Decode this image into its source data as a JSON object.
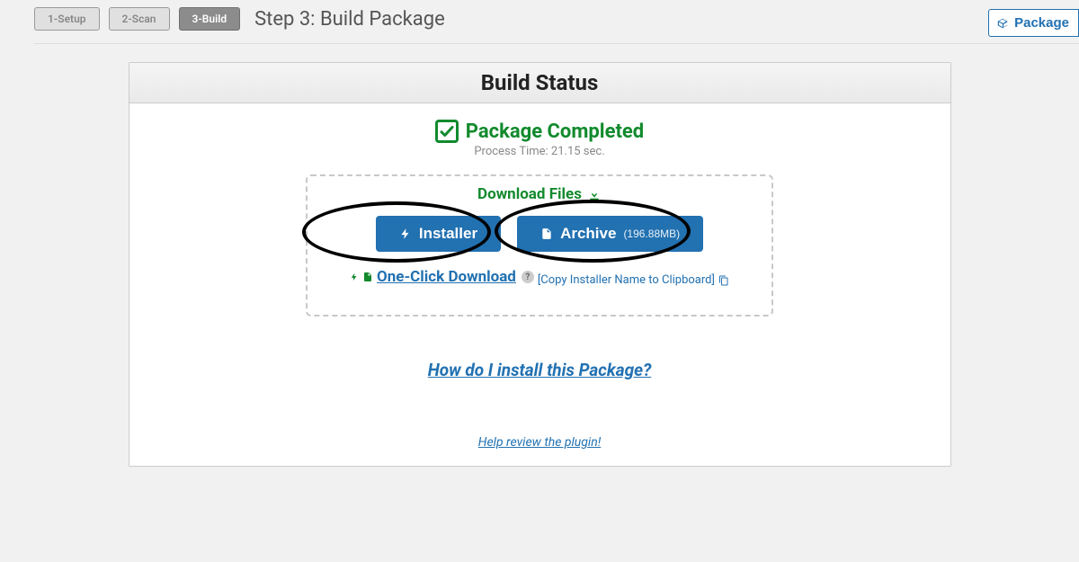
{
  "steps": {
    "s1": "1-Setup",
    "s2": "2-Scan",
    "s3": "3-Build"
  },
  "step_title": "Step 3: Build Package",
  "package_btn": "Package",
  "panel": {
    "title": "Build Status",
    "status": "Package Completed",
    "process_time": "Process Time: 21.15 sec."
  },
  "download": {
    "title": "Download Files",
    "installer": "Installer",
    "archive": "Archive",
    "archive_size": "(196.88MB)",
    "one_click": "One-Click Download",
    "copy": "[Copy Installer Name to Clipboard]"
  },
  "links": {
    "install": "How do I install this Package?",
    "review": "Help review the plugin!"
  }
}
